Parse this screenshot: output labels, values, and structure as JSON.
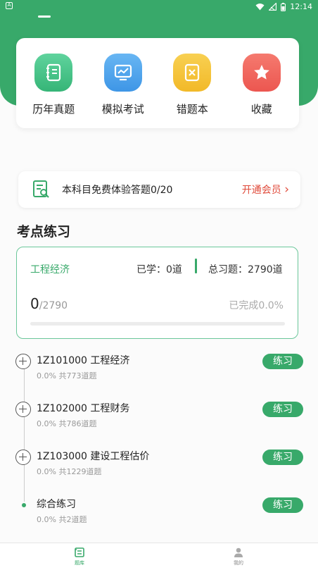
{
  "status_bar": {
    "left_badge": "A",
    "time": "12:14"
  },
  "quick_actions": [
    {
      "label": "历年真题",
      "icon": "book-icon",
      "color": "#43c48a"
    },
    {
      "label": "模拟考试",
      "icon": "chart-screen-icon",
      "color": "#4aa3ec"
    },
    {
      "label": "错题本",
      "icon": "wrong-note-icon",
      "color": "#f5c233"
    },
    {
      "label": "收藏",
      "icon": "star-icon",
      "color": "#f0625a"
    }
  ],
  "trial": {
    "text": "本科目免费体验答题0/20",
    "link": "开通会员",
    "chevron": "›"
  },
  "section_title": "考点练习",
  "practice_card": {
    "subject": "工程经济",
    "learned": "已学：0道",
    "total": "总习题：2790道",
    "count_done": "0",
    "count_total": "/2790",
    "completion": "已完成0.0%",
    "progress": 0
  },
  "chapters": [
    {
      "title": "1Z101000 工程经济",
      "meta": "0.0% 共773道题",
      "button": "练习",
      "icon": "expand-plus-icon"
    },
    {
      "title": "1Z102000 工程财务",
      "meta": "0.0% 共786道题",
      "button": "练习",
      "icon": "expand-plus-icon"
    },
    {
      "title": "1Z103000 建设工程估价",
      "meta": "0.0% 共1229道题",
      "button": "练习",
      "icon": "expand-plus-icon"
    },
    {
      "title": "综合练习",
      "meta": "0.0% 共2道题",
      "button": "练习",
      "icon": "dot-icon"
    }
  ],
  "bottom_nav": [
    {
      "label": "题库",
      "icon": "question-bank-icon",
      "active": true
    },
    {
      "label": "我的",
      "icon": "person-icon",
      "active": false
    }
  ],
  "colors": {
    "brand_green": "#38a96a",
    "link_red": "#e04a3a"
  }
}
